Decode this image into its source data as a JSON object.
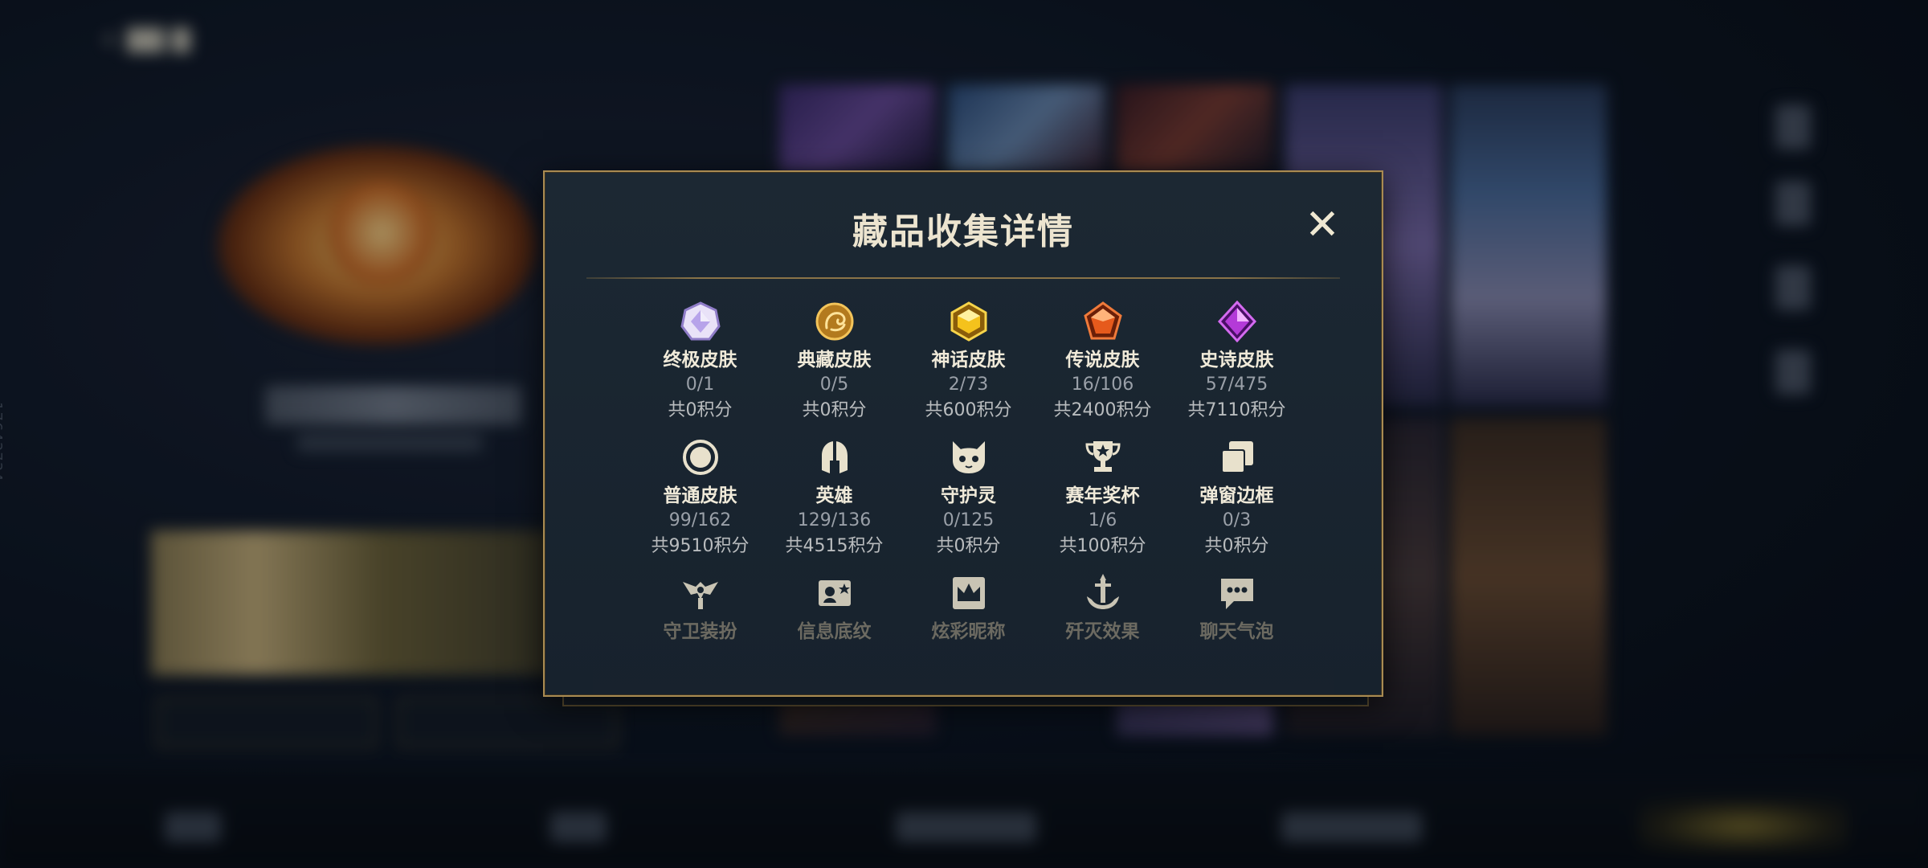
{
  "modal": {
    "title": "藏品收集详情",
    "close_symbol": "✕"
  },
  "categories": [
    {
      "name": "终极皮肤",
      "count": "0/1",
      "points": "共0积分",
      "icon": "ultimate-gem-icon",
      "color": "#c9b7f0"
    },
    {
      "name": "典藏皮肤",
      "count": "0/5",
      "points": "共0积分",
      "icon": "dragon-medallion-icon",
      "color": "#d9a23a"
    },
    {
      "name": "神话皮肤",
      "count": "2/73",
      "points": "共600积分",
      "icon": "mythic-gem-icon",
      "color": "#f0c21e"
    },
    {
      "name": "传说皮肤",
      "count": "16/106",
      "points": "共2400积分",
      "icon": "legendary-gem-icon",
      "color": "#e8642a"
    },
    {
      "name": "史诗皮肤",
      "count": "57/475",
      "points": "共7110积分",
      "icon": "epic-gem-icon",
      "color": "#b23ad6"
    },
    {
      "name": "普通皮肤",
      "count": "99/162",
      "points": "共9510积分",
      "icon": "ring-icon",
      "color": "#e8e1cc"
    },
    {
      "name": "英雄",
      "count": "129/136",
      "points": "共4515积分",
      "icon": "helmet-icon",
      "color": "#e8e1cc"
    },
    {
      "name": "守护灵",
      "count": "0/125",
      "points": "共0积分",
      "icon": "spirit-face-icon",
      "color": "#e8e1cc"
    },
    {
      "name": "赛年奖杯",
      "count": "1/6",
      "points": "共100积分",
      "icon": "trophy-icon",
      "color": "#e8e1cc"
    },
    {
      "name": "弹窗边框",
      "count": "0/3",
      "points": "共0积分",
      "icon": "frame-stack-icon",
      "color": "#e8e1cc"
    },
    {
      "name": "守卫装扮",
      "icon": "ward-icon",
      "color": "#e8e1cc"
    },
    {
      "name": "信息底纹",
      "icon": "card-pattern-icon",
      "color": "#e8e1cc"
    },
    {
      "name": "炫彩昵称",
      "icon": "crown-card-icon",
      "color": "#e8e1cc"
    },
    {
      "name": "歼灭效果",
      "icon": "anchor-blade-icon",
      "color": "#e8e1cc"
    },
    {
      "name": "聊天气泡",
      "icon": "chat-bubble-icon",
      "color": "#e8e1cc"
    }
  ],
  "background": {
    "back_symbol": "‹",
    "side_id": "17643734"
  },
  "colors": {
    "accent_gold": "#a98b52",
    "modal_bg": "#1a2530",
    "title_text": "#ece4cf"
  }
}
